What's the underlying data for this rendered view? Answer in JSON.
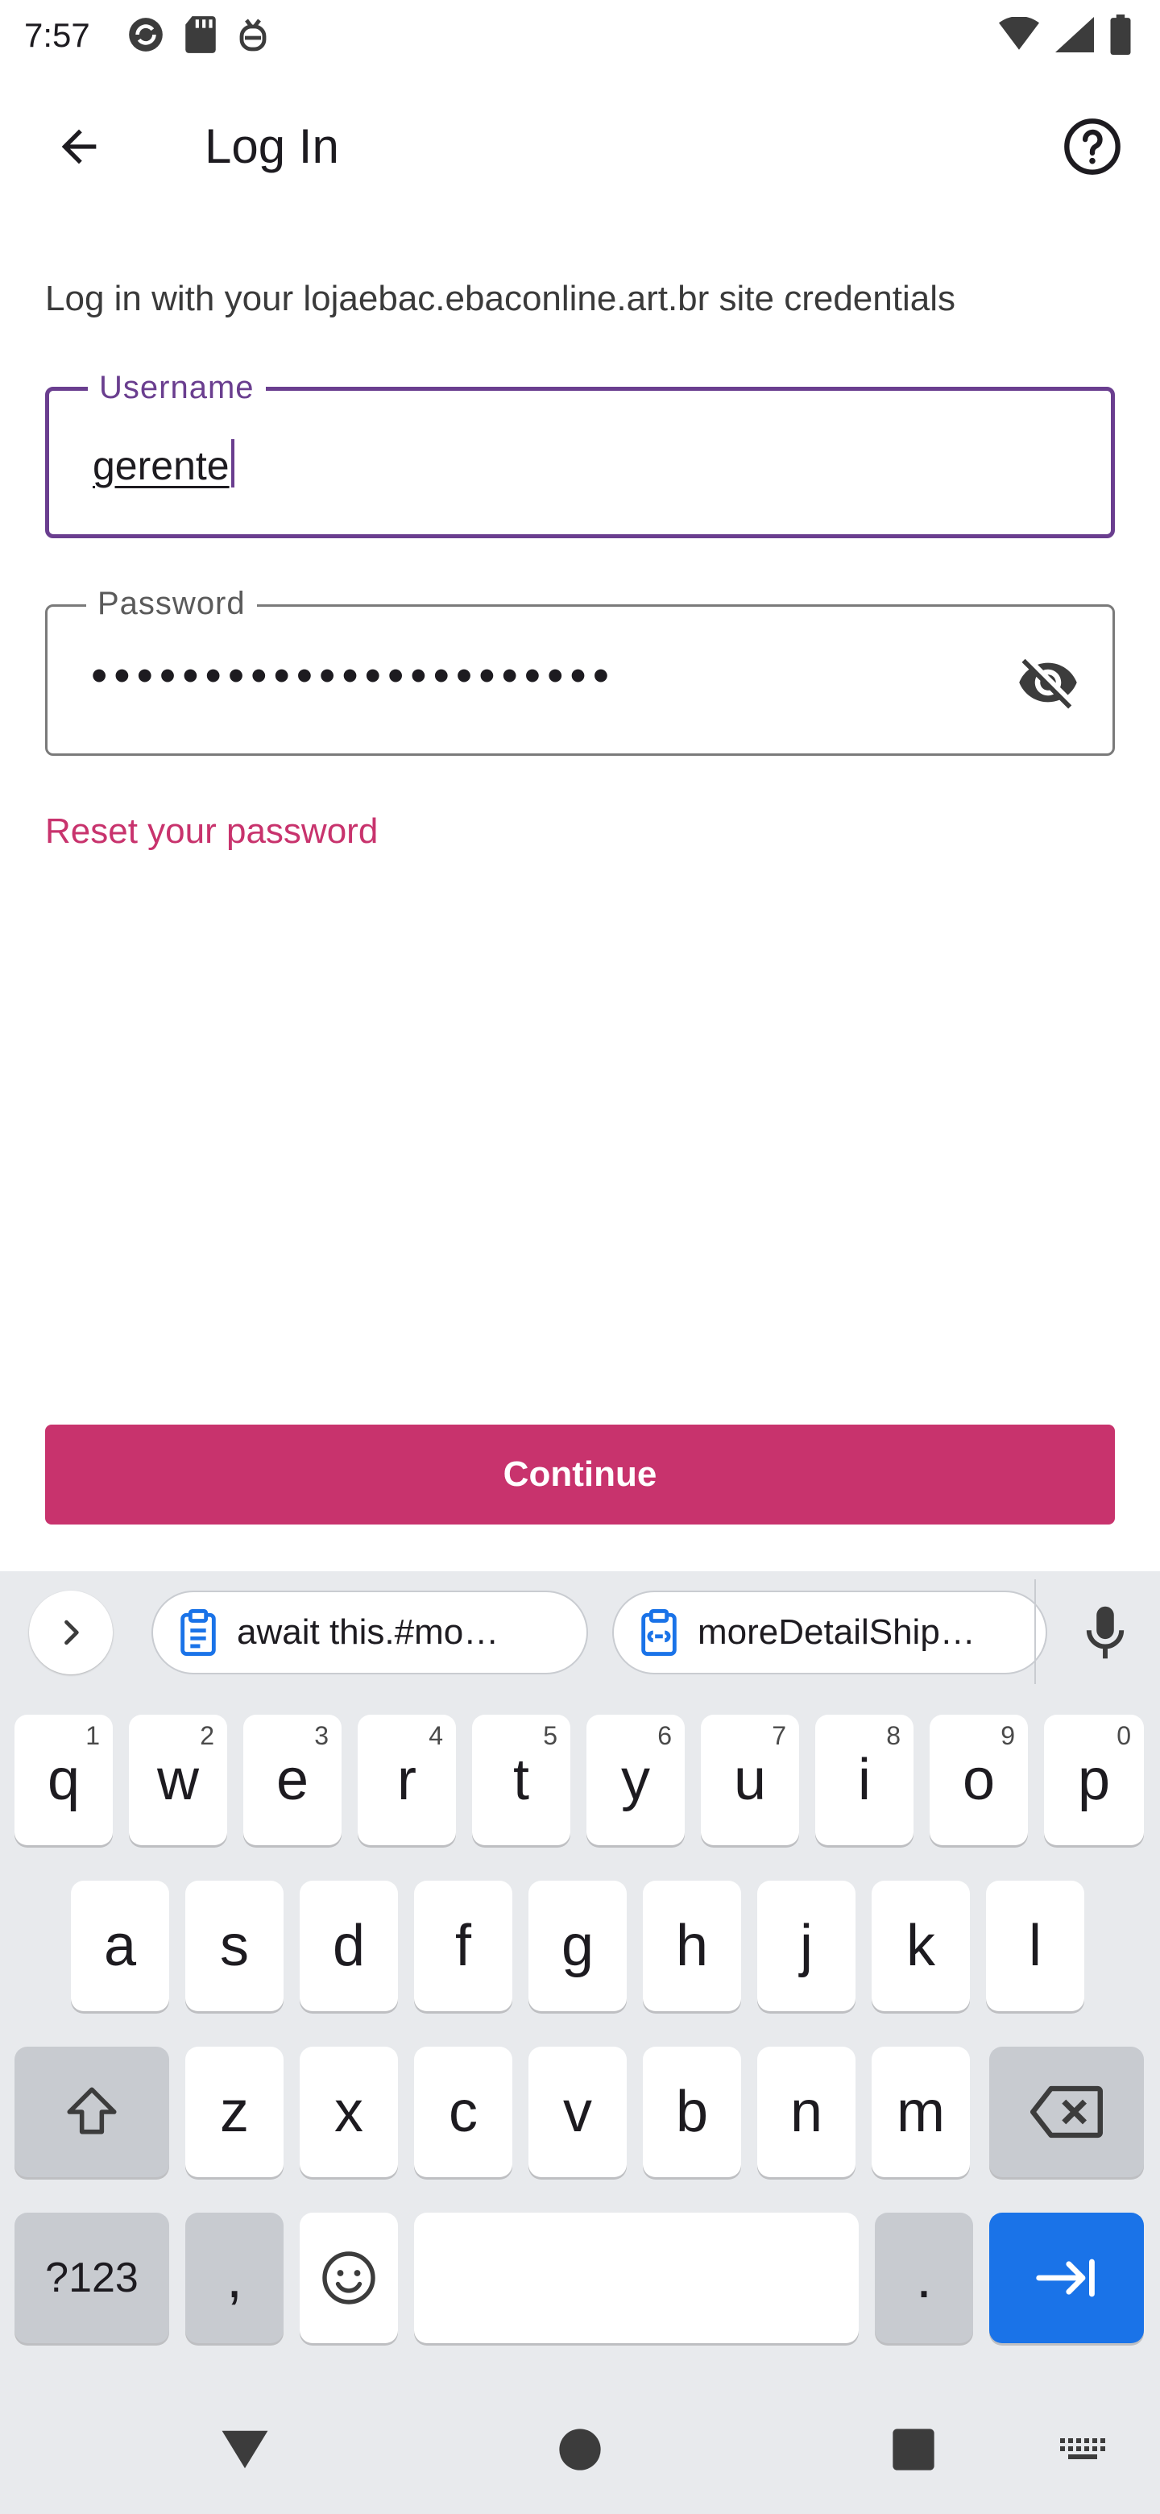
{
  "status_bar": {
    "time": "7:57"
  },
  "app_bar": {
    "title": "Log In"
  },
  "instructions": "Log in with your lojaebac.ebaconline.art.br site credentials",
  "username": {
    "label": "Username",
    "value": "gerente"
  },
  "password": {
    "label": "Password",
    "value": "•••••••••••••••••••••••"
  },
  "reset_link": "Reset your password",
  "continue_label": "Continue",
  "keyboard": {
    "suggestions": [
      "await this.#mo…",
      "moreDetailShip…"
    ],
    "row1": [
      {
        "key": "q",
        "hint": "1"
      },
      {
        "key": "w",
        "hint": "2"
      },
      {
        "key": "e",
        "hint": "3"
      },
      {
        "key": "r",
        "hint": "4"
      },
      {
        "key": "t",
        "hint": "5"
      },
      {
        "key": "y",
        "hint": "6"
      },
      {
        "key": "u",
        "hint": "7"
      },
      {
        "key": "i",
        "hint": "8"
      },
      {
        "key": "o",
        "hint": "9"
      },
      {
        "key": "p",
        "hint": "0"
      }
    ],
    "row2": [
      "a",
      "s",
      "d",
      "f",
      "g",
      "h",
      "j",
      "k",
      "l"
    ],
    "row3": [
      "z",
      "x",
      "c",
      "v",
      "b",
      "n",
      "m"
    ],
    "symbols_label": "?123",
    "comma": ",",
    "period": "."
  },
  "colors": {
    "accent": "#c8336d",
    "focus_outline": "#6a3e8f",
    "enter_key": "#1a73e8",
    "keyboard_bg": "#e8eaed"
  }
}
